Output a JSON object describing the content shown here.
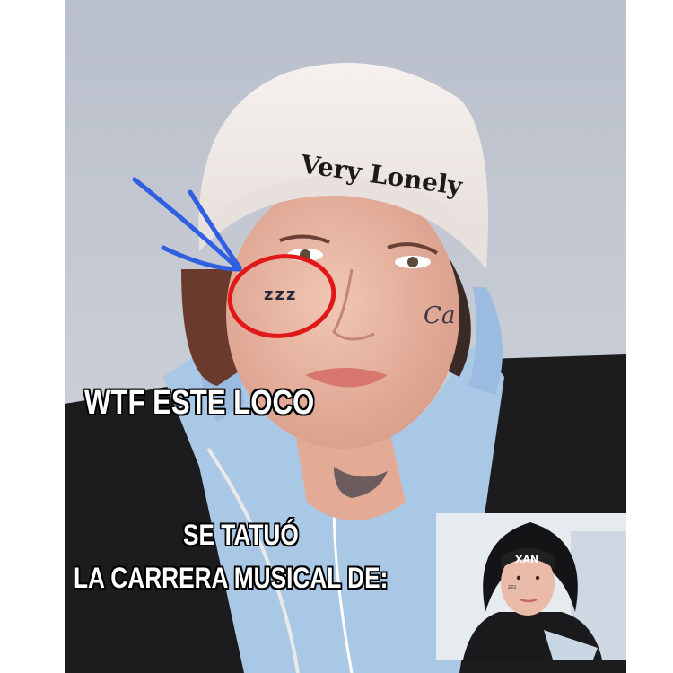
{
  "captions": {
    "line1": "WTF ESTE LOCO",
    "line2": "SE TATUÓ",
    "line3": "LA CARRERA MUSICAL DE:"
  },
  "beanie": {
    "text": "Very Lonely"
  },
  "tattoo": {
    "cheek_text": "zzz",
    "cheek_right_text": "Ca"
  },
  "inset": {
    "beanie_text": "XAN",
    "cheek_text": "zzz"
  },
  "colors": {
    "background": "#ffffff",
    "wall": "#c9cdd6",
    "hoodie": "#a9c8e6",
    "jacket": "#1c1c1e",
    "beanie": "#efe8e6",
    "annotation_blue": "#2f5ee0",
    "annotation_red": "#e01818"
  }
}
